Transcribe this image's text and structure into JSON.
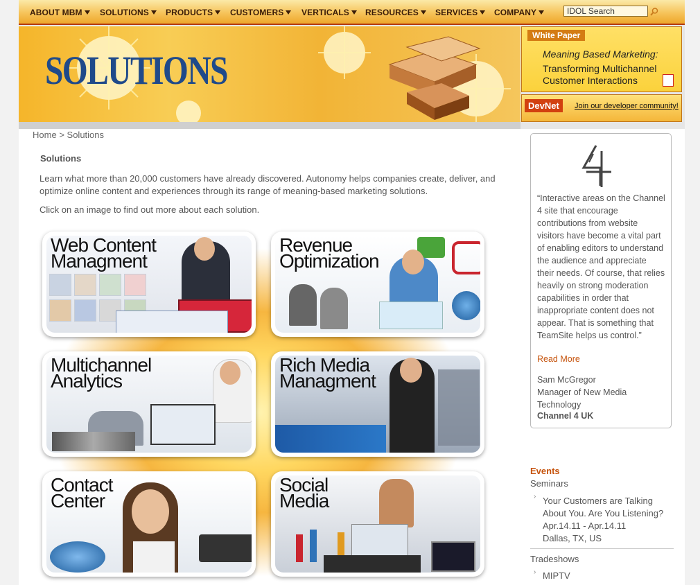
{
  "nav": {
    "items": [
      "ABOUT MBM",
      "SOLUTIONS",
      "PRODUCTS",
      "CUSTOMERS",
      "VERTICALS",
      "RESOURCES",
      "SERVICES",
      "COMPANY"
    ],
    "search_value": "IDOL Search"
  },
  "hero": {
    "title": "SOLUTIONS"
  },
  "whitepaper": {
    "tag": "White Paper",
    "line1": "Meaning Based Marketing:",
    "line2": "Transforming Multichannel",
    "line3": "Customer Interactions"
  },
  "devnet": {
    "tag": "DevNet",
    "link": "Join our developer community!"
  },
  "breadcrumb": {
    "home": "Home",
    "sep": ">",
    "current": "Solutions"
  },
  "main": {
    "heading": "Solutions",
    "intro": "Learn what more than 20,000 customers have already discovered. Autonomy helps companies create, deliver, and optimize online content and experiences through its range of meaning-based marketing solutions.",
    "instruction": "Click on an image to find out more about each solution.",
    "tiles": [
      {
        "line1": "Web Content",
        "line2": "Managment"
      },
      {
        "line1": "Revenue",
        "line2": "Optimization"
      },
      {
        "line1": "Multichannel",
        "line2": "Analytics"
      },
      {
        "line1": "Rich Media",
        "line2": "Managment"
      },
      {
        "line1": "Contact",
        "line2": "Center"
      },
      {
        "line1": "Social",
        "line2": "Media"
      }
    ]
  },
  "testimonial": {
    "quote": "“Interactive areas on the Channel 4 site that encourage contributions from website visitors have become a vital part of enabling editors to understand the audience and appreciate their needs. Of course, that relies heavily on strong moderation capabilities in order that inappropriate content does not appear. That is something that TeamSite helps us control.”",
    "read_more": "Read More",
    "name": "Sam McGregor",
    "title": "Manager of New Media Technology",
    "org": "Channel 4 UK"
  },
  "events": {
    "heading": "Events",
    "seminars_label": "Seminars",
    "seminar_title": "Your Customers are Talking About You. Are You Listening?",
    "seminar_date": "Apr.14.11 - Apr.14.11",
    "seminar_place": "Dallas, TX, US",
    "tradeshows_label": "Tradeshows",
    "tradeshow_title": "MIPTV"
  }
}
